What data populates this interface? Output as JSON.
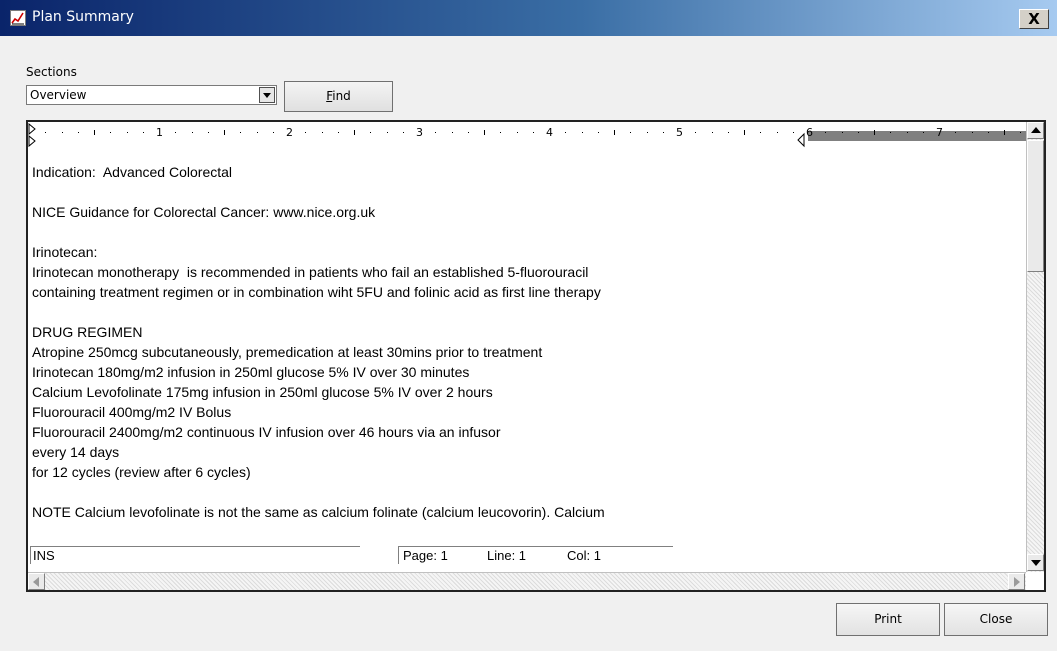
{
  "window": {
    "title": "Plan Summary",
    "close_glyph": "X"
  },
  "sections": {
    "label": "Sections",
    "selected": "Overview"
  },
  "find_button": {
    "label": "Find",
    "mnemonic": "F"
  },
  "ruler": {
    "numbers": [
      "1",
      "2",
      "3",
      "4",
      "5",
      "6",
      "7"
    ]
  },
  "document": {
    "paragraphs": [
      [
        "Indication:  Advanced Colorectal"
      ],
      [
        "NICE Guidance for Colorectal Cancer: www.nice.org.uk"
      ],
      [
        "Irinotecan:",
        "Irinotecan monotherapy  is recommended in patients who fail an established 5-fluorouracil",
        "containing treatment regimen or in combination wiht 5FU and folinic acid as first line therapy"
      ],
      [
        "DRUG REGIMEN",
        "Atropine 250mcg subcutaneously, premedication at least 30mins prior to treatment",
        "Irinotecan 180mg/m2 infusion in 250ml glucose 5% IV over 30 minutes",
        "Calcium Levofolinate 175mg infusion in 250ml glucose 5% IV over 2 hours",
        "Fluorouracil 400mg/m2 IV Bolus",
        "Fluorouracil 2400mg/m2 continuous IV infusion over 46 hours via an infusor",
        "every 14 days",
        "for 12 cycles (review after 6 cycles)"
      ],
      [
        "NOTE Calcium levofolinate is not the same as calcium folinate (calcium leucovorin). Calcium"
      ]
    ]
  },
  "status": {
    "mode": "INS",
    "page": "Page: 1",
    "line": "Line: 1",
    "col": "Col: 1"
  },
  "buttons": {
    "print": "Print",
    "close": "Close"
  },
  "colors": {
    "title_bar_start": "#0a246a",
    "title_bar_end": "#a6caf0",
    "ruler_margin": "#808080"
  }
}
